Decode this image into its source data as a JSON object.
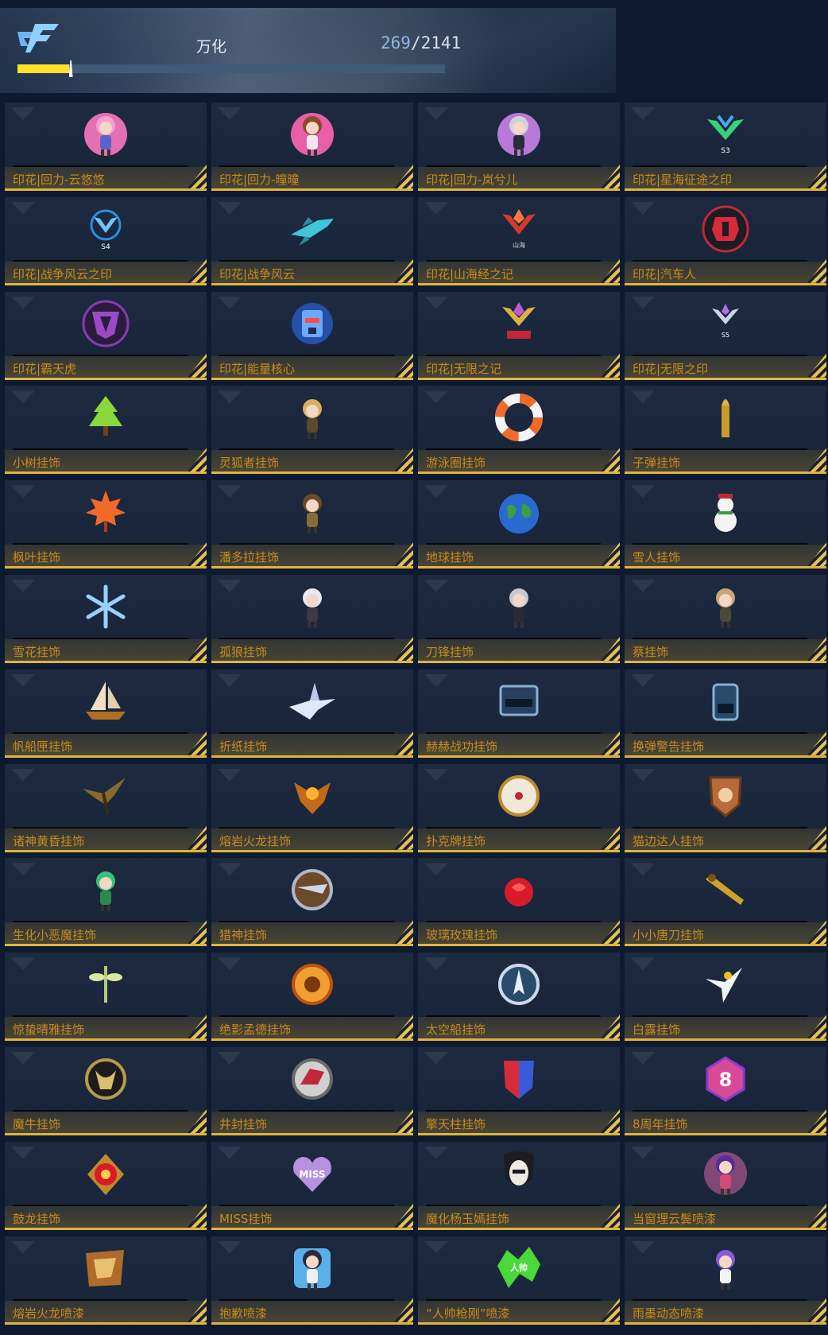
{
  "header": {
    "name": "万化",
    "count_current": "269",
    "count_separator": "/",
    "count_total": "2141",
    "progress": 0.12
  },
  "colors": {
    "background": "#0d1a30",
    "label": "#c98a1c",
    "accent_gold": "#e0b43c",
    "progress_fill": "#ffe229",
    "count_highlight": "#8fb6e6"
  },
  "items": [
    {
      "label": "印花|回力-云悠悠",
      "icon": "chibi-girl-pink-icon"
    },
    {
      "label": "印花|回力-曈曈",
      "icon": "chibi-girl-brown-icon"
    },
    {
      "label": "印花|回力-岚兮儿",
      "icon": "chibi-girl-silver-icon"
    },
    {
      "label": "印花|星海征途之印",
      "icon": "season-emblem-green-icon"
    },
    {
      "label": "印花|战争风云之印",
      "icon": "season-emblem-blue-icon"
    },
    {
      "label": "印花|战争风云",
      "icon": "aircraft-icon"
    },
    {
      "label": "印花|山海经之记",
      "icon": "red-emblem-icon"
    },
    {
      "label": "印花|汽车人",
      "icon": "autobot-icon"
    },
    {
      "label": "印花|霸天虎",
      "icon": "decepticon-icon"
    },
    {
      "label": "印花|能量核心",
      "icon": "robot-head-icon"
    },
    {
      "label": "印花|无限之记",
      "icon": "infinity-emblem-gold-icon"
    },
    {
      "label": "印花|无限之印",
      "icon": "infinity-emblem-silver-icon"
    },
    {
      "label": "小树挂饰",
      "icon": "tree-icon"
    },
    {
      "label": "灵狐者挂饰",
      "icon": "chibi-blonde-icon"
    },
    {
      "label": "游泳圈挂饰",
      "icon": "swim-ring-icon"
    },
    {
      "label": "子弹挂饰",
      "icon": "bullet-icon"
    },
    {
      "label": "枫叶挂饰",
      "icon": "maple-leaf-icon"
    },
    {
      "label": "潘多拉挂饰",
      "icon": "chibi-soldier-icon"
    },
    {
      "label": "地球挂饰",
      "icon": "globe-icon"
    },
    {
      "label": "雪人挂饰",
      "icon": "snowman-icon"
    },
    {
      "label": "雪花挂饰",
      "icon": "snowflake-icon"
    },
    {
      "label": "孤狼挂饰",
      "icon": "chibi-white-hair-icon"
    },
    {
      "label": "刀锋挂饰",
      "icon": "chibi-masked-icon"
    },
    {
      "label": "蔡挂饰",
      "icon": "chibi-eyepatch-icon"
    },
    {
      "label": "帆船匣挂饰",
      "icon": "sailboat-icon"
    },
    {
      "label": "折纸挂饰",
      "icon": "paper-crane-icon"
    },
    {
      "label": "赫赫战功挂饰",
      "icon": "score-panel-icon"
    },
    {
      "label": "换弹警告挂饰",
      "icon": "ammo-warning-icon"
    },
    {
      "label": "诸神黄昏挂饰",
      "icon": "winged-dragon-icon"
    },
    {
      "label": "熔岩火龙挂饰",
      "icon": "fire-dragon-icon"
    },
    {
      "label": "扑克牌挂饰",
      "icon": "poker-chip-icon"
    },
    {
      "label": "猫边达人挂饰",
      "icon": "shield-badge-icon"
    },
    {
      "label": "生化小恶魔挂饰",
      "icon": "green-imp-icon"
    },
    {
      "label": "猎神挂饰",
      "icon": "silver-medallion-icon"
    },
    {
      "label": "玻璃玫瑰挂饰",
      "icon": "glass-rose-icon"
    },
    {
      "label": "小小唐刀挂饰",
      "icon": "golden-blade-icon"
    },
    {
      "label": "惊蛰晴雅挂饰",
      "icon": "dragonfly-icon"
    },
    {
      "label": "绝影孟德挂饰",
      "icon": "lion-medallion-icon"
    },
    {
      "label": "太空船挂饰",
      "icon": "spaceship-medallion-icon"
    },
    {
      "label": "白露挂饰",
      "icon": "bird-icon"
    },
    {
      "label": "魔牛挂饰",
      "icon": "bull-medallion-icon"
    },
    {
      "label": "井封挂饰",
      "icon": "dino-medallion-icon"
    },
    {
      "label": "擎天柱挂饰",
      "icon": "optimus-shield-icon"
    },
    {
      "label": "8周年挂饰",
      "icon": "eight-anniversary-icon"
    },
    {
      "label": "鼓龙挂饰",
      "icon": "red-orb-medallion-icon"
    },
    {
      "label": "MISS挂饰",
      "icon": "miss-heart-icon"
    },
    {
      "label": "魔化杨玉嫣挂饰",
      "icon": "masked-lady-icon"
    },
    {
      "label": "当窗理云鬓喷漆",
      "icon": "chibi-purple-hair-icon"
    },
    {
      "label": "熔岩火龙喷漆",
      "icon": "lava-dragon-spray-icon"
    },
    {
      "label": "抱歉喷漆",
      "icon": "chibi-sorry-icon"
    },
    {
      "label": "“人帅枪刚”喷漆",
      "icon": "green-graffiti-icon"
    },
    {
      "label": "雨墨动态喷漆",
      "icon": "chibi-violet-icon"
    }
  ]
}
